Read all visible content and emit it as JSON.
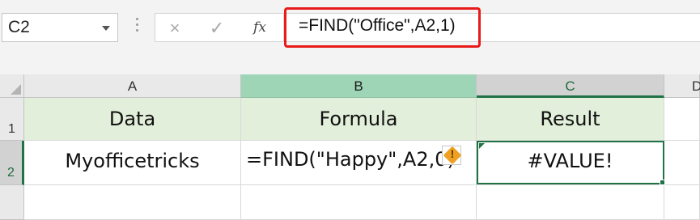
{
  "formula_bar": {
    "name_box": "C2",
    "cancel_icon": "×",
    "enter_icon": "✓",
    "insert_function_icon": "fx",
    "formula": "=FIND(\"Office\",A2,1)",
    "highlight_color": "#e81a1a"
  },
  "columns": [
    {
      "label": "A",
      "state": "normal"
    },
    {
      "label": "B",
      "state": "highlighted"
    },
    {
      "label": "C",
      "state": "selected"
    },
    {
      "label": "D",
      "state": "normal"
    }
  ],
  "rows": [
    "1",
    "2"
  ],
  "table": {
    "headers": [
      "Data",
      "Formula",
      "Result"
    ],
    "row2": {
      "data": "Myofficetricks",
      "formula": "=FIND(\"Happy\",A2,0)",
      "result": "#VALUE!"
    }
  },
  "error_indicator": {
    "icon": "warning-icon",
    "symbol": "!"
  },
  "colors": {
    "header_fill": "#e2efda",
    "selection_accent": "#217346",
    "column_b_header": "#9fd5b7"
  }
}
